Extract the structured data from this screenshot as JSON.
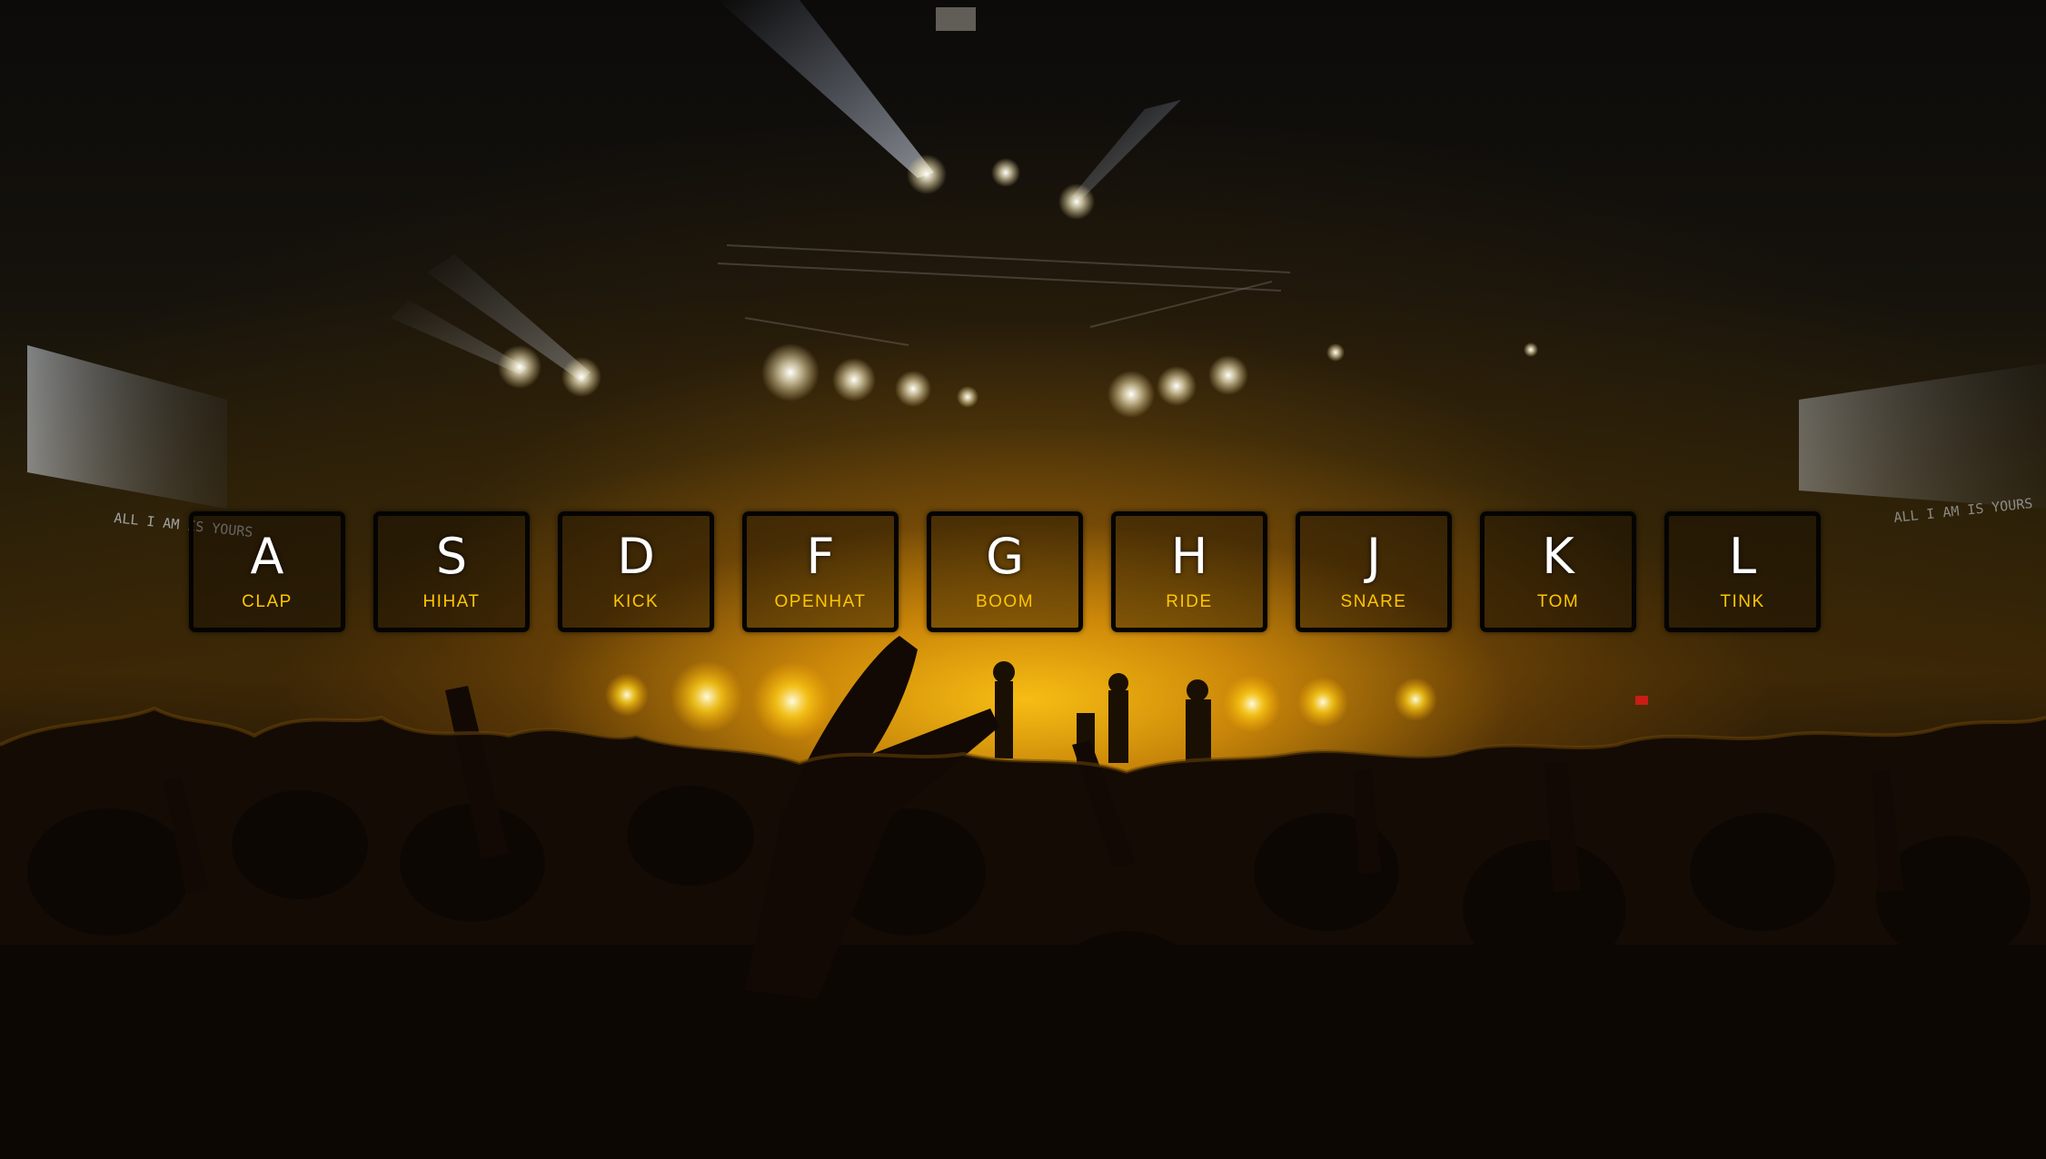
{
  "accent_color": "#ffc600",
  "screens": {
    "left_caption": "ALL I AM IS YOURS",
    "right_caption": "ALL I AM IS YOURS"
  },
  "drum_keys": [
    {
      "key": "A",
      "sound": "clap"
    },
    {
      "key": "S",
      "sound": "hihat"
    },
    {
      "key": "D",
      "sound": "kick"
    },
    {
      "key": "F",
      "sound": "openhat"
    },
    {
      "key": "G",
      "sound": "boom"
    },
    {
      "key": "H",
      "sound": "ride"
    },
    {
      "key": "J",
      "sound": "snare"
    },
    {
      "key": "K",
      "sound": "tom"
    },
    {
      "key": "L",
      "sound": "tink"
    }
  ]
}
